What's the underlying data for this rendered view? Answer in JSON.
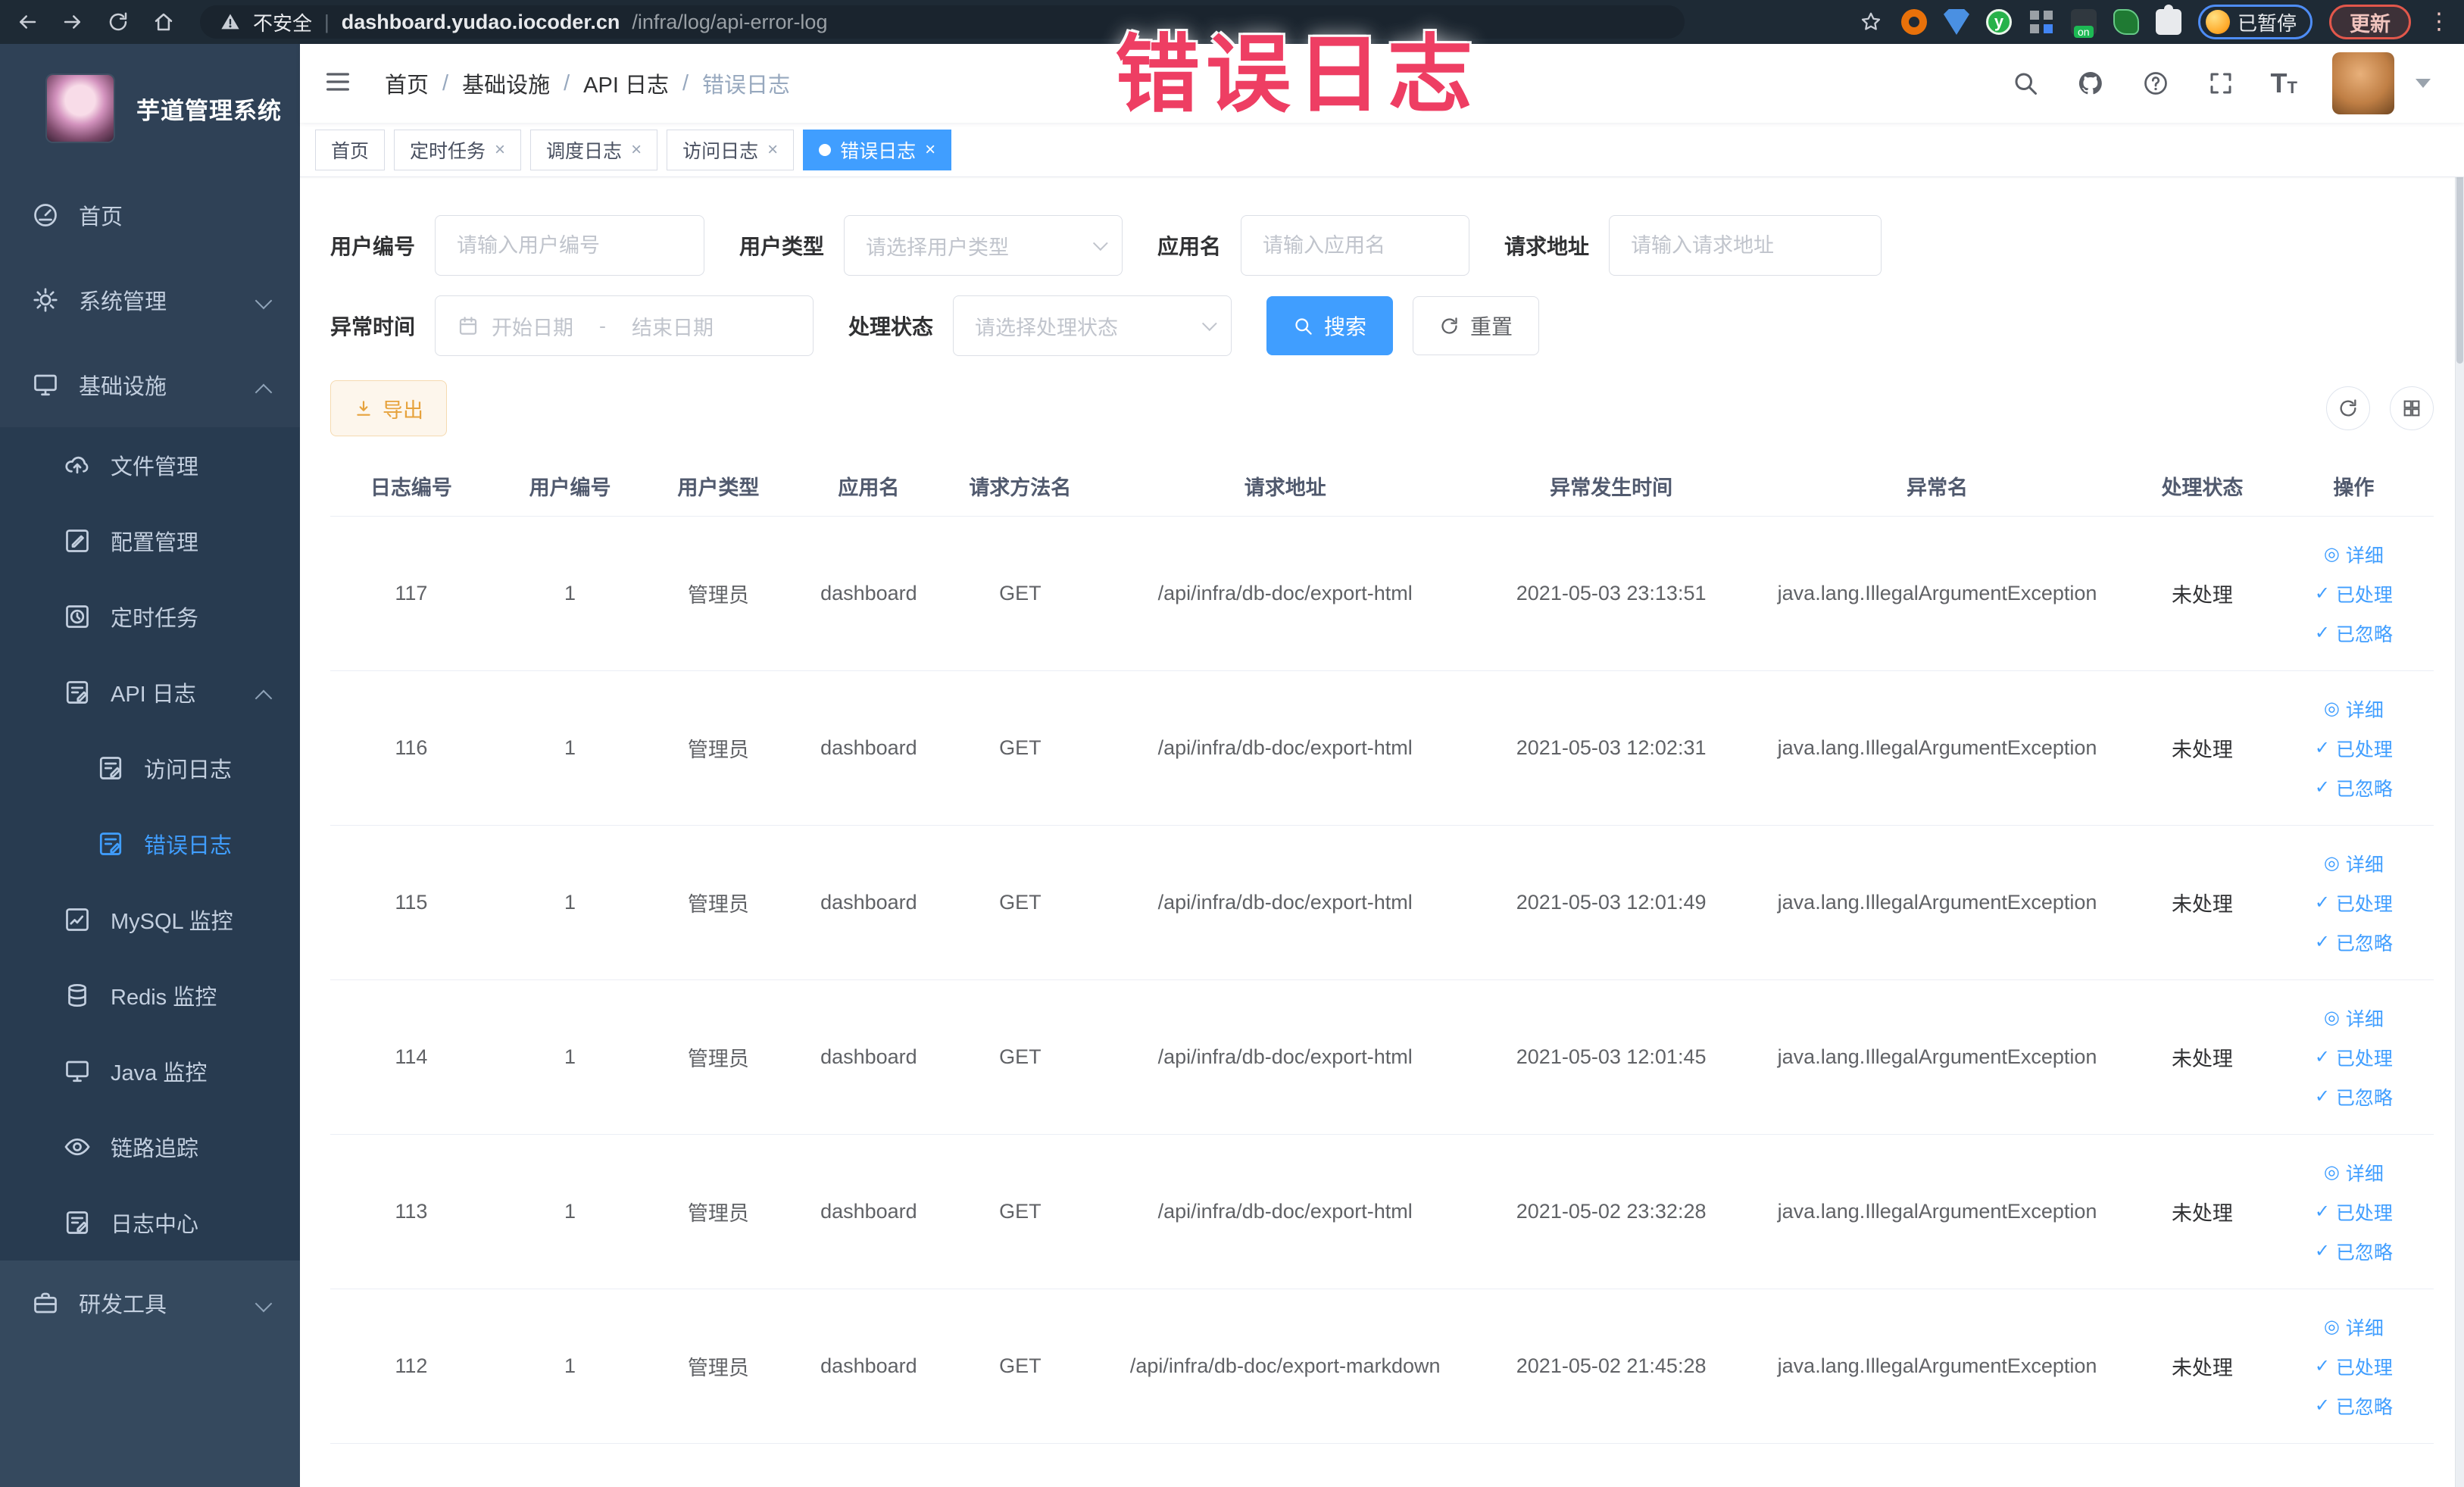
{
  "browser": {
    "security_label": "不安全",
    "url_host": "dashboard.yudao.iocoder.cn",
    "url_path": "/infra/log/api-error-log",
    "ext_y_letter": "y",
    "paused_badge": "已暂停",
    "update_button": "更新",
    "kebab": "⋮"
  },
  "annotation": {
    "text": "错误日志"
  },
  "sidebar": {
    "title": "芋道管理系统",
    "items": [
      {
        "label": "首页"
      },
      {
        "label": "系统管理"
      },
      {
        "label": "基础设施"
      },
      {
        "label": "文件管理"
      },
      {
        "label": "配置管理"
      },
      {
        "label": "定时任务"
      },
      {
        "label": "API 日志"
      },
      {
        "label": "访问日志"
      },
      {
        "label": "错误日志"
      },
      {
        "label": "MySQL 监控"
      },
      {
        "label": "Redis 监控"
      },
      {
        "label": "Java 监控"
      },
      {
        "label": "链路追踪"
      },
      {
        "label": "日志中心"
      },
      {
        "label": "研发工具"
      }
    ]
  },
  "breadcrumb": {
    "items": [
      "首页",
      "基础设施",
      "API 日志",
      "错误日志"
    ],
    "separator": "/"
  },
  "tabs": [
    {
      "label": "首页"
    },
    {
      "label": "定时任务"
    },
    {
      "label": "调度日志"
    },
    {
      "label": "访问日志"
    },
    {
      "label": "错误日志"
    }
  ],
  "filters": {
    "user_id": {
      "label": "用户编号",
      "placeholder": "请输入用户编号"
    },
    "user_type": {
      "label": "用户类型",
      "placeholder": "请选择用户类型"
    },
    "app_name": {
      "label": "应用名",
      "placeholder": "请输入应用名"
    },
    "request_url": {
      "label": "请求地址",
      "placeholder": "请输入请求地址"
    },
    "exception_time": {
      "label": "异常时间",
      "start_placeholder": "开始日期",
      "separator": "-",
      "end_placeholder": "结束日期"
    },
    "process_status": {
      "label": "处理状态",
      "placeholder": "请选择处理状态"
    },
    "search_label": "搜索",
    "reset_label": "重置"
  },
  "toolbar": {
    "export_label": "导出"
  },
  "table": {
    "columns": [
      "日志编号",
      "用户编号",
      "用户类型",
      "应用名",
      "请求方法名",
      "请求地址",
      "异常发生时间",
      "异常名",
      "处理状态",
      "操作"
    ],
    "actions": {
      "detail": "详细",
      "processed": "已处理",
      "ignored": "已忽略"
    },
    "rows": [
      {
        "id": "117",
        "user_id": "1",
        "user_type": "管理员",
        "app": "dashboard",
        "method": "GET",
        "url": "/api/infra/db-doc/export-html",
        "time": "2021-05-03 23:13:51",
        "exception": "java.lang.IllegalArgumentException",
        "status": "未处理"
      },
      {
        "id": "116",
        "user_id": "1",
        "user_type": "管理员",
        "app": "dashboard",
        "method": "GET",
        "url": "/api/infra/db-doc/export-html",
        "time": "2021-05-03 12:02:31",
        "exception": "java.lang.IllegalArgumentException",
        "status": "未处理"
      },
      {
        "id": "115",
        "user_id": "1",
        "user_type": "管理员",
        "app": "dashboard",
        "method": "GET",
        "url": "/api/infra/db-doc/export-html",
        "time": "2021-05-03 12:01:49",
        "exception": "java.lang.IllegalArgumentException",
        "status": "未处理"
      },
      {
        "id": "114",
        "user_id": "1",
        "user_type": "管理员",
        "app": "dashboard",
        "method": "GET",
        "url": "/api/infra/db-doc/export-html",
        "time": "2021-05-03 12:01:45",
        "exception": "java.lang.IllegalArgumentException",
        "status": "未处理"
      },
      {
        "id": "113",
        "user_id": "1",
        "user_type": "管理员",
        "app": "dashboard",
        "method": "GET",
        "url": "/api/infra/db-doc/export-html",
        "time": "2021-05-02 23:32:28",
        "exception": "java.lang.IllegalArgumentException",
        "status": "未处理"
      },
      {
        "id": "112",
        "user_id": "1",
        "user_type": "管理员",
        "app": "dashboard",
        "method": "GET",
        "url": "/api/infra/db-doc/export-markdown",
        "time": "2021-05-02 21:45:28",
        "exception": "java.lang.IllegalArgumentException",
        "status": "未处理"
      }
    ]
  },
  "colors": {
    "primary": "#409EFF",
    "warning": "#e6a23c",
    "annotation": "#ee3e63",
    "sidebar_bg": "#2f4156"
  }
}
